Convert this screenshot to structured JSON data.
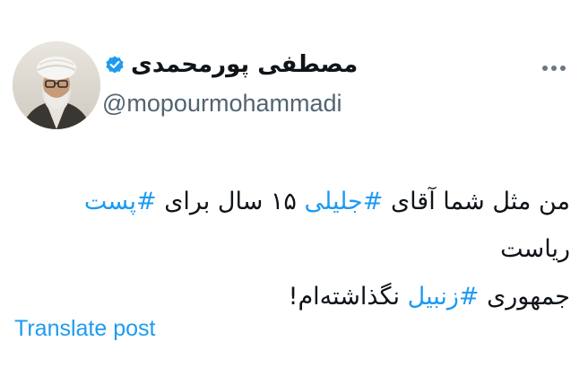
{
  "author": {
    "display_name": "مصطفی پورمحمدی",
    "handle": "@mopourmohammadi",
    "verified": true
  },
  "tweet": {
    "line1": {
      "t1": "من مثل شما آقای ",
      "h1": "#جلیلی",
      "t2": " ۱۵ سال برای ",
      "h2": "#پست",
      "t3": " ریاست"
    },
    "line2": {
      "t1": "جمهوری ",
      "h1": "#زنبیل",
      "t2": " نگذاشته‌ام!"
    }
  },
  "actions": {
    "translate_label": "Translate post"
  },
  "colors": {
    "link": "#1d9bf0",
    "text": "#0f1419",
    "secondary": "#536471"
  },
  "icons": {
    "verified": "verified-badge-icon",
    "more": "more-options-icon"
  }
}
